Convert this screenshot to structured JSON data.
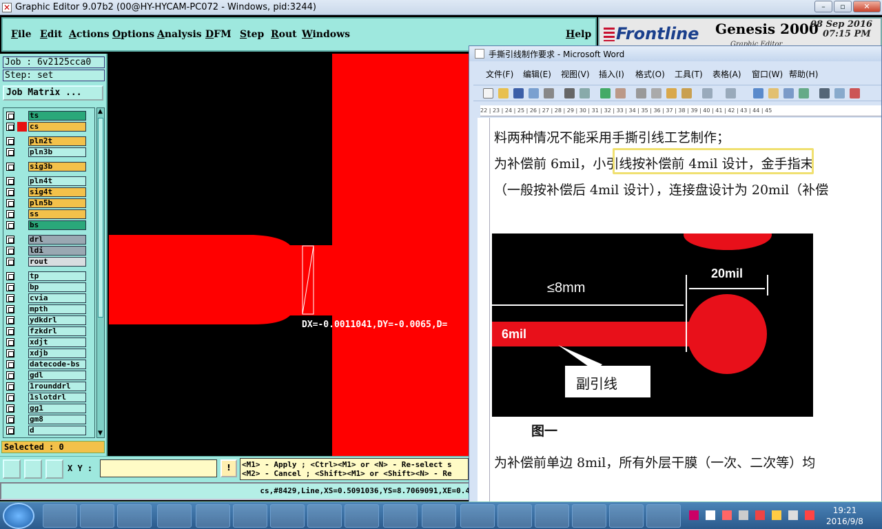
{
  "genesis": {
    "title": "Graphic Editor 9.07b2 (00@HY-HYCAM-PC072 - Windows, pid:3244)",
    "menu": [
      "File",
      "Edit",
      "Actions",
      "Options",
      "Analysis",
      "DFM",
      "Step",
      "Rout",
      "Windows",
      "Help"
    ],
    "brand": "Frontline",
    "product": "Genesis 2000",
    "product_sub": "Graphic Editor",
    "date": "08 Sep 2016",
    "time": "07:15 PM",
    "job": "Job : 6v2125cca0",
    "step": "Step: set",
    "job_matrix": "Job Matrix ...",
    "layers": [
      {
        "name": "ts",
        "color": "#2aa87a",
        "mark": ""
      },
      {
        "name": "cs",
        "color": "#f3c14a",
        "mark": "■"
      },
      {
        "name": "pln2t",
        "color": "#f3c14a",
        "mark": ""
      },
      {
        "name": "pln3b",
        "color": "#b4efe6",
        "mark": ""
      },
      {
        "name": "sig3b",
        "color": "#f3c14a",
        "mark": ""
      },
      {
        "name": "pln4t",
        "color": "#b4efe6",
        "mark": ""
      },
      {
        "name": "sig4t",
        "color": "#f3c14a",
        "mark": ""
      },
      {
        "name": "pln5b",
        "color": "#f3c14a",
        "mark": ""
      },
      {
        "name": "ss",
        "color": "#f3c14a",
        "mark": ""
      },
      {
        "name": "bs",
        "color": "#2aa87a",
        "mark": ""
      },
      {
        "name": "drl",
        "color": "#9aa8b2",
        "mark": ""
      },
      {
        "name": "ldi",
        "color": "#9aa8b2",
        "mark": ""
      },
      {
        "name": "rout",
        "color": "#d8dde0",
        "mark": ""
      },
      {
        "name": "tp",
        "color": "#b4efe6",
        "mark": ""
      },
      {
        "name": "bp",
        "color": "#b4efe6",
        "mark": ""
      },
      {
        "name": "cvia",
        "color": "#b4efe6",
        "mark": ""
      },
      {
        "name": "mpth",
        "color": "#b4efe6",
        "mark": ""
      },
      {
        "name": "ydkdrl",
        "color": "#b4efe6",
        "mark": ""
      },
      {
        "name": "fzkdrl",
        "color": "#b4efe6",
        "mark": ""
      },
      {
        "name": "xdjt",
        "color": "#b4efe6",
        "mark": ""
      },
      {
        "name": "xdjb",
        "color": "#b4efe6",
        "mark": ""
      },
      {
        "name": "datecode-bs",
        "color": "#b4efe6",
        "mark": ""
      },
      {
        "name": "gdl",
        "color": "#b4efe6",
        "mark": ""
      },
      {
        "name": "1rounddrl",
        "color": "#b4efe6",
        "mark": ""
      },
      {
        "name": "1slotdrl",
        "color": "#b4efe6",
        "mark": ""
      },
      {
        "name": "gg1",
        "color": "#b4efe6",
        "mark": ""
      },
      {
        "name": "gm8",
        "color": "#b4efe6",
        "mark": ""
      },
      {
        "name": "d",
        "color": "#b4efe6",
        "mark": ""
      }
    ],
    "selected": "Selected : 0",
    "measure": "DX=-0.0011041,DY=-0.0065,D=",
    "xy_label": "X Y :",
    "xy_value": "",
    "hint1": "<M1> - Apply  ; <Ctrl><M1> or <N> - Re-select s",
    "hint2": "<M2> - Cancel ; <Shift><M1> or <Shift><N> - Re",
    "status": "cs,#8429,Line,XS=0.5091036,YS=8.7069091,XE=0.4"
  },
  "word": {
    "title": "手撕引线制作要求 - Microsoft Word",
    "menu": [
      "文件(F)",
      "编辑(E)",
      "视图(V)",
      "插入(I)",
      "格式(O)",
      "工具(T)",
      "表格(A)",
      "窗口(W)",
      "帮助(H)"
    ],
    "ruler": "22 | 23 | 24 | 25 | 26 | 27 | 28 | 29 | 30 | 31 | 32 | 33 | 34 | 35 | 36 | 37 | 38 | 39 | 40 | 41 | 42 | 43 | 44 | 45",
    "line1": "料两种情况不能采用手撕引线工艺制作；",
    "line2a": "为补偿前 6mil，",
    "line2b": "小引线按补偿前 4mil 设计，",
    "line2c": "金手指末",
    "line3": "（一般按补偿后 4mil 设计），连接盘设计为 20mil（补偿",
    "fig_label_8mm": "≤8mm",
    "fig_label_20mil": "20mil",
    "fig_label_6mil": "6mil",
    "fig_label_sub": "副引线",
    "caption": "图一",
    "line4": "为补偿前单边 8mil，所有外层干膜（一次、二次等）均"
  },
  "taskbar": {
    "time": "19:21",
    "date": "2016/9/8"
  }
}
